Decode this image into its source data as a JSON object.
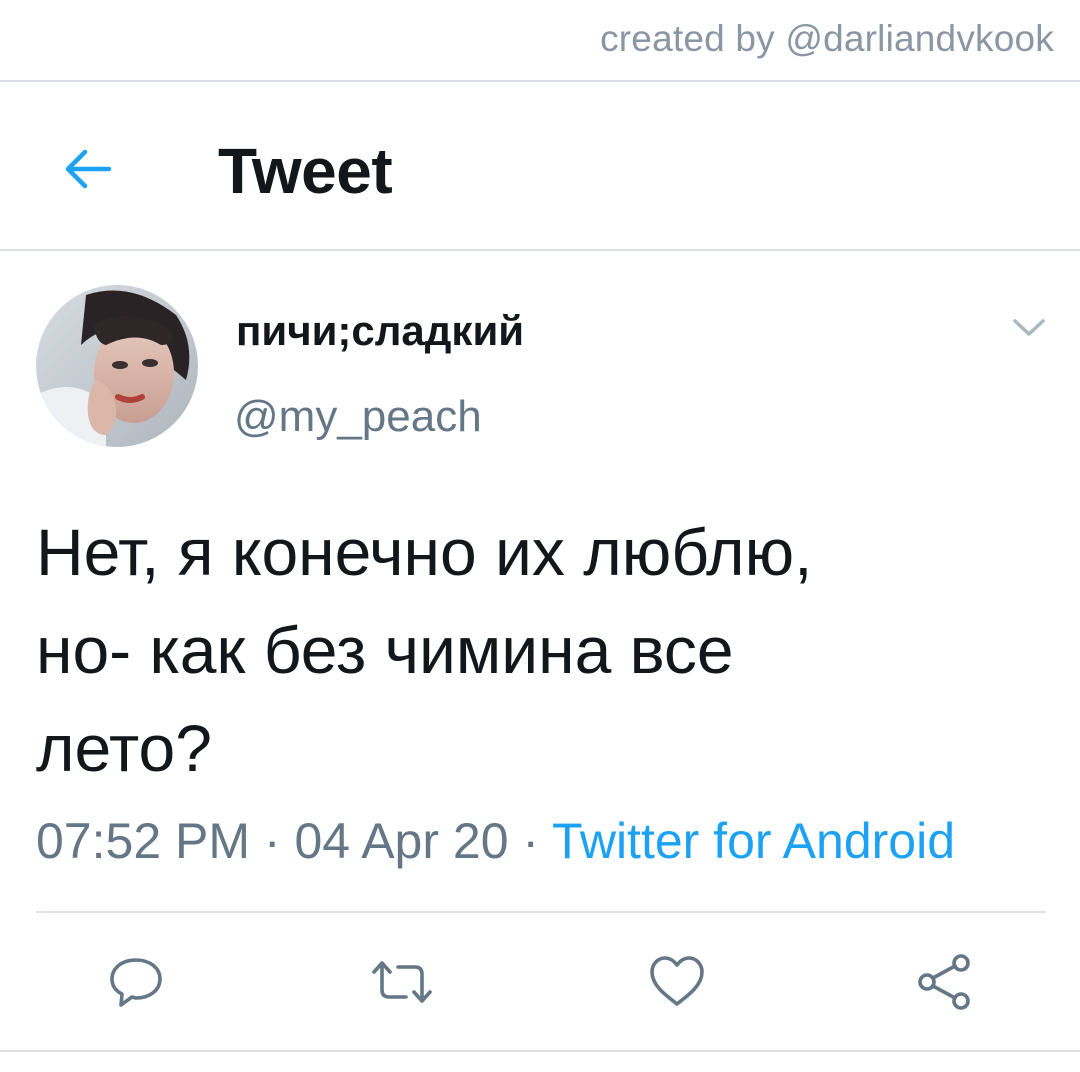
{
  "watermark": {
    "text": "created by @darliandvkook"
  },
  "header": {
    "title": "Tweet",
    "back_icon": "arrow-left-icon"
  },
  "tweet": {
    "author": {
      "display_name": "пичи;сладкий",
      "handle": "@my_peach",
      "avatar": "avatar-photo"
    },
    "text": "Нет, я конечно их люблю,\nно- как без чимина все\nлето?",
    "time": "07:52 PM",
    "separator": " · ",
    "date": "04 Apr 20",
    "source": "Twitter for Android",
    "menu_icon": "chevron-down-icon"
  },
  "actions": [
    {
      "name": "reply",
      "icon": "reply-icon"
    },
    {
      "name": "retweet",
      "icon": "retweet-icon"
    },
    {
      "name": "like",
      "icon": "heart-icon"
    },
    {
      "name": "share",
      "icon": "share-icon"
    }
  ],
  "colors": {
    "accent": "#1da1f2",
    "text_primary": "#14171a",
    "text_secondary": "#657786",
    "divider": "#d9dfe4",
    "icon_gray": "#657786"
  }
}
